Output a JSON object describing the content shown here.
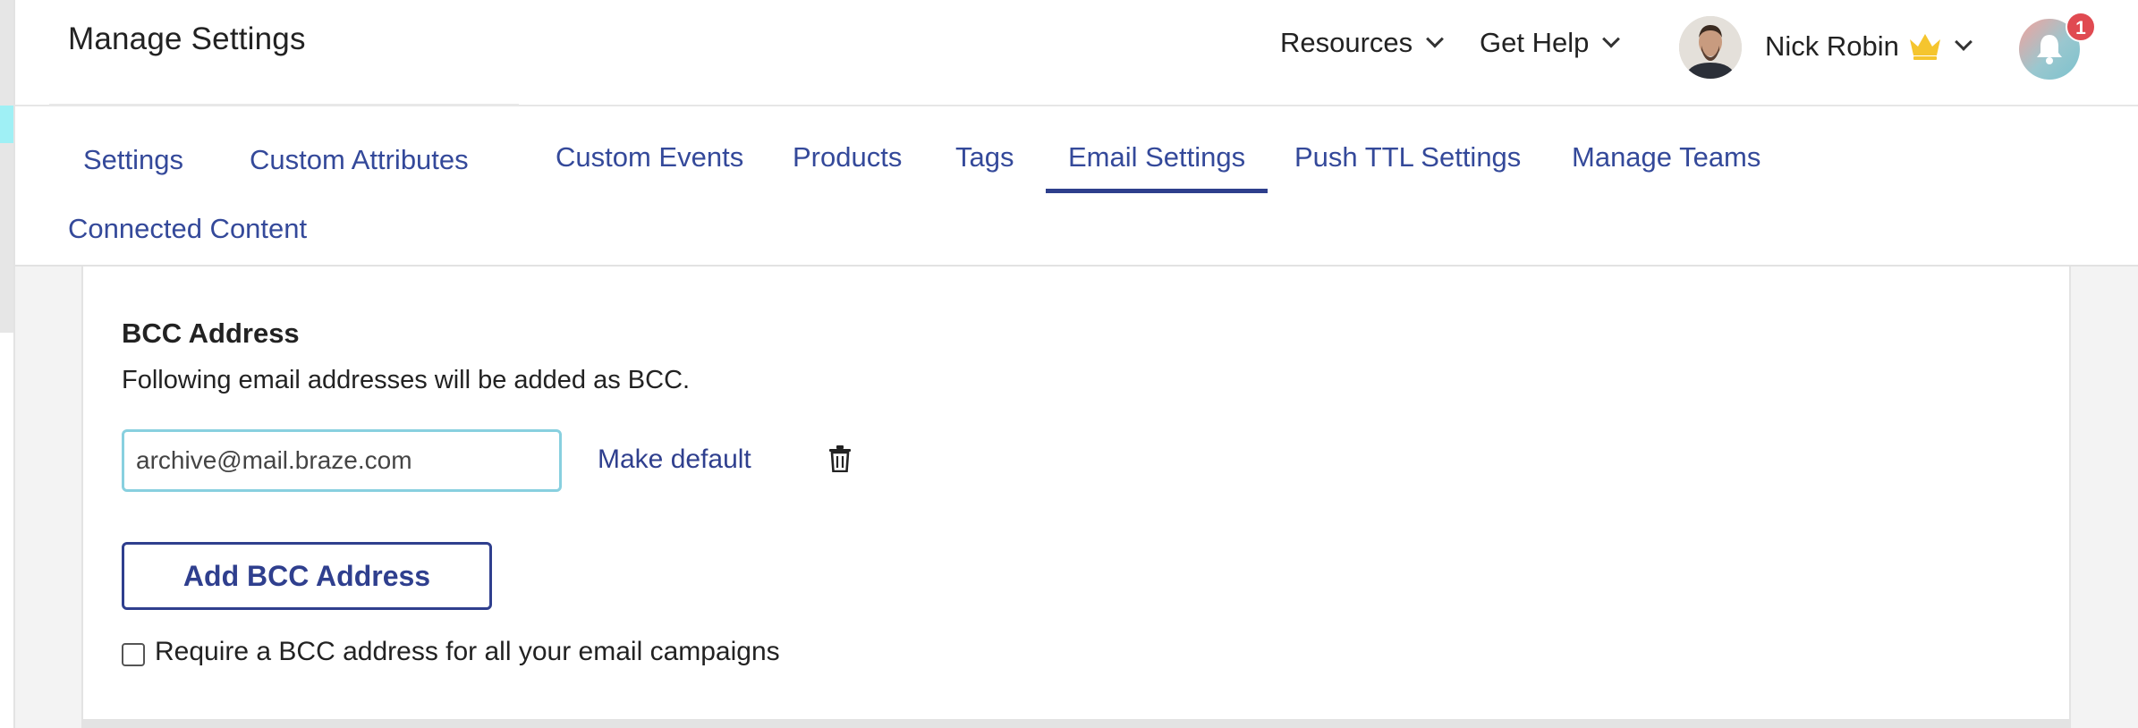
{
  "header": {
    "title": "Manage Settings",
    "resources_label": "Resources",
    "get_help_label": "Get Help",
    "user_name": "Nick Robin",
    "notification_count": "1",
    "crown_color": "#f5c52e",
    "badge_color": "#e04a51"
  },
  "tabs": [
    {
      "label": "Settings",
      "active": false
    },
    {
      "label": "Custom Attributes",
      "active": false
    },
    {
      "label": "Custom Events",
      "active": false
    },
    {
      "label": "Products",
      "active": false
    },
    {
      "label": "Tags",
      "active": false
    },
    {
      "label": "Email Settings",
      "active": true
    },
    {
      "label": "Push TTL Settings",
      "active": false
    },
    {
      "label": "Manage Teams",
      "active": false
    },
    {
      "label": "Connected Content",
      "active": false
    }
  ],
  "bcc": {
    "title": "BCC Address",
    "description": "Following email addresses will be added as BCC.",
    "address_value": "archive@mail.braze.com",
    "make_default_label": "Make default",
    "add_button_label": "Add BCC Address",
    "require_label": "Require a BCC address for all your email campaigns",
    "require_checked": false
  },
  "colors": {
    "accent": "#2f3f8e",
    "link": "#34499a",
    "input_focus_border": "#88d0df"
  }
}
